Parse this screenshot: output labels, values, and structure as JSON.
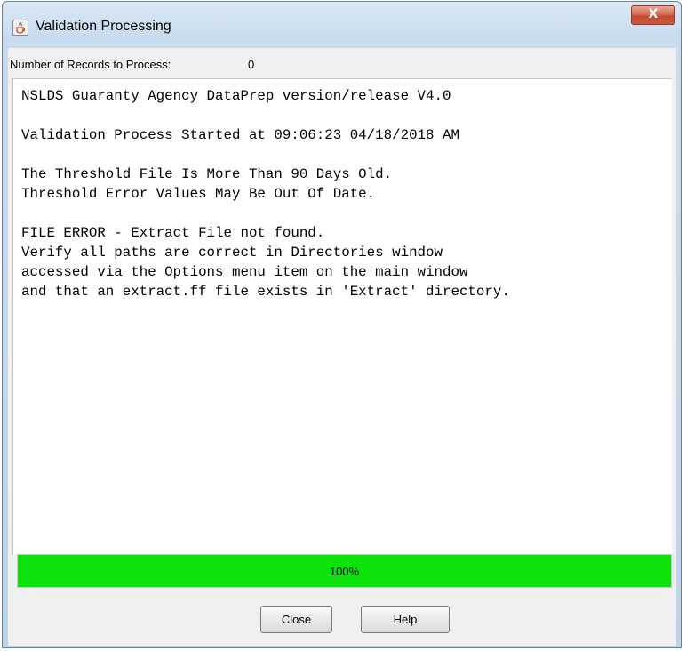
{
  "window": {
    "title": "Validation Processing",
    "close_glyph": "X",
    "app_icon": "java-cup-icon"
  },
  "records": {
    "label": "Number of Records to Process:",
    "value": "0"
  },
  "log": {
    "lines": [
      "NSLDS Guaranty Agency DataPrep version/release V4.0",
      "",
      "Validation Process Started at 09:06:23 04/18/2018 AM",
      "",
      "The Threshold File Is More Than 90 Days Old.",
      "Threshold Error Values May Be Out Of Date.",
      "",
      "FILE ERROR - Extract File not found.",
      "Verify all paths are correct in Directories window",
      "accessed via the Options menu item on the main window",
      "and that an extract.ff file exists in 'Extract' directory."
    ]
  },
  "progress": {
    "value": 1.0,
    "text": "100%",
    "color": "#0be30b"
  },
  "buttons": {
    "close_label": "Close",
    "help_label": "Help"
  }
}
